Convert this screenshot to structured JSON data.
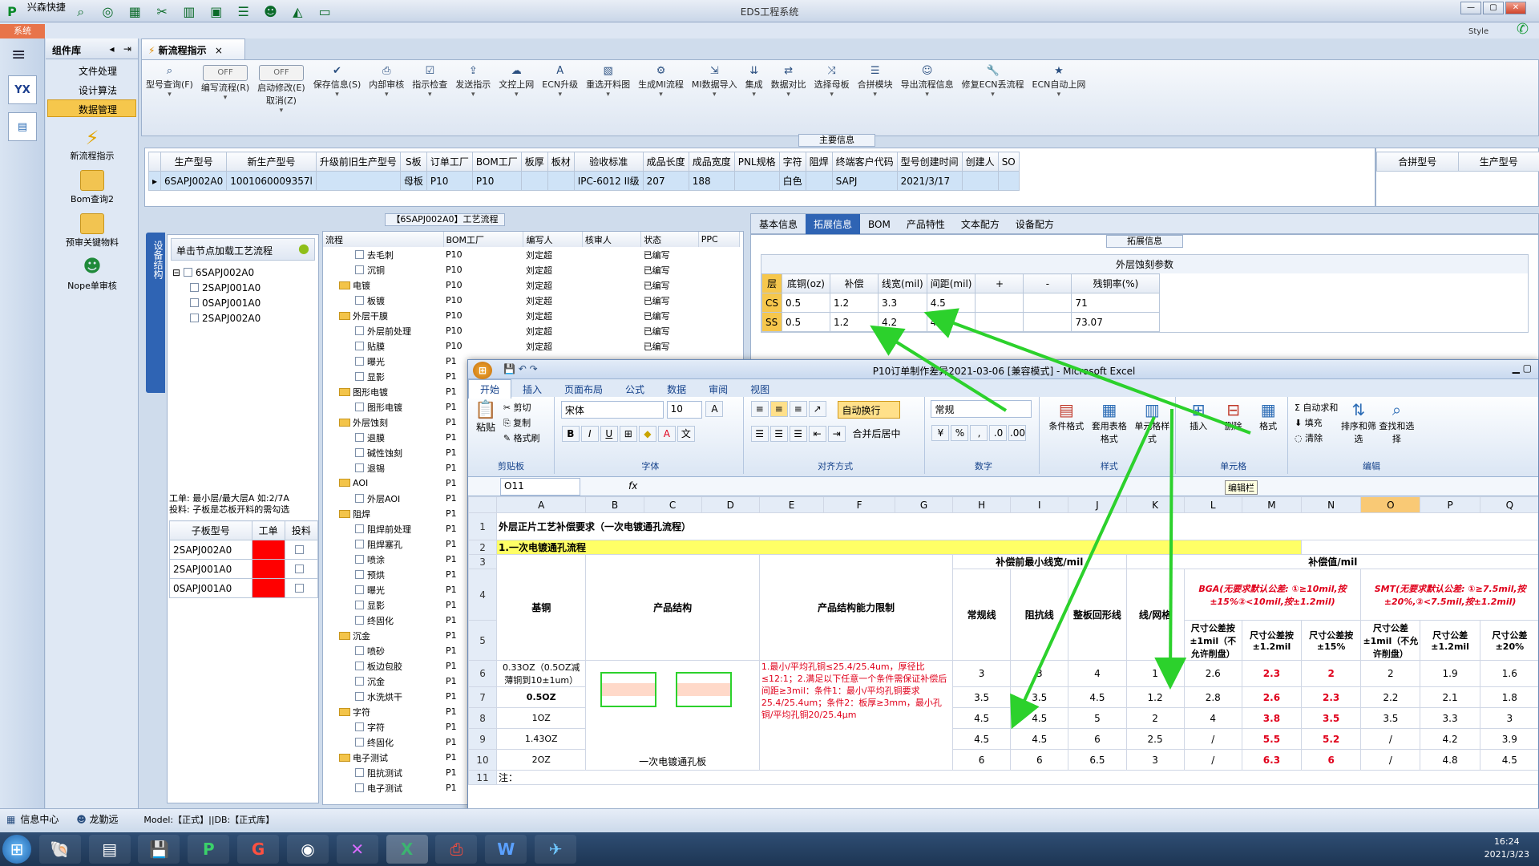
{
  "app": {
    "quick_label": "兴森快捷",
    "title": "EDS工程系统",
    "system_tab": "系统",
    "style_label": "Style"
  },
  "complib": {
    "title": "组件库",
    "items": [
      "文件处理",
      "设计算法",
      "数据管理"
    ],
    "big": [
      "新流程指示",
      "Bom查询2",
      "预审关键物料",
      "Nope单审核"
    ]
  },
  "doc_tab": {
    "label": "新流程指示"
  },
  "ribbon": {
    "items": [
      {
        "icon": "search",
        "label": "型号查询(F)"
      },
      {
        "toggle": "OFF",
        "label": "编写流程(R)"
      },
      {
        "toggle": "OFF",
        "label": "启动修改(E)",
        "label2": "取消(Z)"
      },
      {
        "icon": "check",
        "label": "保存信息(S)"
      },
      {
        "icon": "print",
        "label": "内部审核"
      },
      {
        "icon": "check2",
        "label": "指示检查"
      },
      {
        "icon": "up",
        "label": "发送指示"
      },
      {
        "icon": "cloud",
        "label": "文控上网"
      },
      {
        "icon": "A",
        "label": "ECN升级"
      },
      {
        "icon": "img",
        "label": "重选开料图"
      },
      {
        "icon": "gear",
        "label": "生成MI流程"
      },
      {
        "icon": "import",
        "label": "MI数据导入"
      },
      {
        "icon": "merge",
        "label": "集成"
      },
      {
        "icon": "compare",
        "label": "数据对比"
      },
      {
        "icon": "shuffle",
        "label": "选择母板"
      },
      {
        "icon": "list",
        "label": "合拼模块"
      },
      {
        "icon": "smile",
        "label": "导出流程信息"
      },
      {
        "icon": "wrench",
        "label": "修复ECN丢流程"
      },
      {
        "icon": "star",
        "label": "ECN自动上网"
      }
    ]
  },
  "main_info": {
    "title": "主要信息",
    "columns": [
      "生产型号",
      "新生产型号",
      "升级前旧生产型号",
      "S板",
      "订单工厂",
      "BOM工厂",
      "板厚",
      "板材",
      "验收标准",
      "成品长度",
      "成品宽度",
      "PNL规格",
      "字符",
      "阻焊",
      "终端客户代码",
      "型号创建时间",
      "创建人",
      "SO"
    ],
    "row": [
      "6SAPJ002A0",
      "1001060009357l",
      "",
      "母板",
      "P10",
      "P10",
      "",
      "",
      "IPC-6012 II级",
      "207",
      "188",
      "",
      "白色",
      "",
      "SAPJ",
      "2021/3/17",
      "",
      ""
    ],
    "right_columns": [
      "合拼型号",
      "生产型号"
    ]
  },
  "process_panel": {
    "title": "【6SAPJ002A0】工艺流程",
    "side_tab": "设备结构",
    "load_hint": "单击节点加载工艺流程",
    "tree": [
      "6SAPJ002A0",
      "2SAPJ001A0",
      "0SAPJ001A0",
      "2SAPJ002A0"
    ],
    "note1": "工单: 最小层/最大层A 如:2/7A",
    "note2": "投料: 子板是芯板开料的需勾选",
    "sub_cols": [
      "子板型号",
      "工单",
      "投料"
    ],
    "sub_rows": [
      "2SAPJ002A0",
      "2SAPJ001A0",
      "0SAPJ001A0"
    ]
  },
  "flow": {
    "cols": [
      "流程",
      "BOM工厂",
      "编写人",
      "核审人",
      "状态",
      "PPC"
    ],
    "rows": [
      {
        "name": "去毛刺",
        "lvl": 2,
        "f": "P10",
        "w": "刘定超",
        "s": "已编写"
      },
      {
        "name": "沉铜",
        "lvl": 2,
        "f": "P10",
        "w": "刘定超",
        "s": "已编写"
      },
      {
        "name": "电镀",
        "lvl": 1,
        "f": "P10",
        "w": "刘定超",
        "s": "已编写"
      },
      {
        "name": "板镀",
        "lvl": 2,
        "f": "P10",
        "w": "刘定超",
        "s": "已编写"
      },
      {
        "name": "外层干膜",
        "lvl": 1,
        "f": "P10",
        "w": "刘定超",
        "s": "已编写"
      },
      {
        "name": "外层前处理",
        "lvl": 2,
        "f": "P10",
        "w": "刘定超",
        "s": "已编写"
      },
      {
        "name": "贴膜",
        "lvl": 2,
        "f": "P10",
        "w": "刘定超",
        "s": "已编写"
      },
      {
        "name": "曝光",
        "lvl": 2,
        "f": "P1",
        "w": "",
        "s": ""
      },
      {
        "name": "显影",
        "lvl": 2,
        "f": "P1",
        "w": "",
        "s": ""
      },
      {
        "name": "图形电镀",
        "lvl": 1,
        "f": "P1",
        "w": "",
        "s": ""
      },
      {
        "name": "图形电镀",
        "lvl": 2,
        "f": "P1",
        "w": "",
        "s": ""
      },
      {
        "name": "外层蚀刻",
        "lvl": 1,
        "f": "P1",
        "w": "",
        "s": ""
      },
      {
        "name": "退膜",
        "lvl": 2,
        "f": "P1",
        "w": "",
        "s": ""
      },
      {
        "name": "碱性蚀刻",
        "lvl": 2,
        "f": "P1",
        "w": "",
        "s": ""
      },
      {
        "name": "退锡",
        "lvl": 2,
        "f": "P1",
        "w": "",
        "s": ""
      },
      {
        "name": "AOI",
        "lvl": 1,
        "f": "P1",
        "w": "",
        "s": ""
      },
      {
        "name": "外层AOI",
        "lvl": 2,
        "f": "P1",
        "w": "",
        "s": ""
      },
      {
        "name": "阻焊",
        "lvl": 1,
        "f": "P1",
        "w": "",
        "s": ""
      },
      {
        "name": "阻焊前处理",
        "lvl": 2,
        "f": "P1",
        "w": "",
        "s": ""
      },
      {
        "name": "阻焊塞孔",
        "lvl": 2,
        "f": "P1",
        "w": "",
        "s": ""
      },
      {
        "name": "喷涂",
        "lvl": 2,
        "f": "P1",
        "w": "",
        "s": ""
      },
      {
        "name": "预烘",
        "lvl": 2,
        "f": "P1",
        "w": "",
        "s": ""
      },
      {
        "name": "曝光",
        "lvl": 2,
        "f": "P1",
        "w": "",
        "s": ""
      },
      {
        "name": "显影",
        "lvl": 2,
        "f": "P1",
        "w": "",
        "s": ""
      },
      {
        "name": "终固化",
        "lvl": 2,
        "f": "P1",
        "w": "",
        "s": ""
      },
      {
        "name": "沉金",
        "lvl": 1,
        "f": "P1",
        "w": "",
        "s": ""
      },
      {
        "name": "喷砂",
        "lvl": 2,
        "f": "P1",
        "w": "",
        "s": ""
      },
      {
        "name": "板边包胶",
        "lvl": 2,
        "f": "P1",
        "w": "",
        "s": ""
      },
      {
        "name": "沉金",
        "lvl": 2,
        "f": "P1",
        "w": "",
        "s": ""
      },
      {
        "name": "水洗烘干",
        "lvl": 2,
        "f": "P1",
        "w": "",
        "s": ""
      },
      {
        "name": "字符",
        "lvl": 1,
        "f": "P1",
        "w": "",
        "s": ""
      },
      {
        "name": "字符",
        "lvl": 2,
        "f": "P1",
        "w": "",
        "s": ""
      },
      {
        "name": "终固化",
        "lvl": 2,
        "f": "P1",
        "w": "",
        "s": ""
      },
      {
        "name": "电子测试",
        "lvl": 1,
        "f": "P1",
        "w": "",
        "s": ""
      },
      {
        "name": "阻抗测试",
        "lvl": 2,
        "f": "P1",
        "w": "",
        "s": ""
      },
      {
        "name": "电子测试",
        "lvl": 2,
        "f": "P1",
        "w": "",
        "s": ""
      }
    ]
  },
  "detail": {
    "tabs": [
      "基本信息",
      "拓展信息",
      "BOM",
      "产品特性",
      "文本配方",
      "设备配方"
    ],
    "section": "拓展信息",
    "table_title": "外层蚀刻参数",
    "cols": [
      "层",
      "底铜(oz)",
      "补偿",
      "线宽(mil)",
      "间距(mil)",
      "+",
      "-",
      "残铜率(%)"
    ],
    "rows": [
      [
        "CS",
        "0.5",
        "1.2",
        "3.3",
        "4.5",
        "",
        "",
        "71"
      ],
      [
        "SS",
        "0.5",
        "1.2",
        "4.2",
        "4.5",
        "",
        "",
        "73.07"
      ]
    ]
  },
  "excel": {
    "title": "P10订单制作差异2021-03-06 [兼容模式] - Microsoft Excel",
    "tabs": [
      "开始",
      "插入",
      "页面布局",
      "公式",
      "数据",
      "审阅",
      "视图"
    ],
    "font": "宋体",
    "size": "10",
    "numfmt": "常规",
    "namebox": "O11",
    "groups": [
      "剪贴板",
      "字体",
      "对齐方式",
      "数字",
      "样式",
      "单元格",
      "编辑"
    ],
    "clip": [
      "剪切",
      "复制",
      "格式刷",
      "粘贴"
    ],
    "wrap": "自动换行",
    "mergec": "合并后居中",
    "styles": [
      "条件格式",
      "套用表格格式",
      "单元格样式"
    ],
    "cells": [
      "插入",
      "删除",
      "格式"
    ],
    "edit": [
      "自动求和",
      "填充",
      "清除",
      "排序和筛选",
      "查找和选择"
    ],
    "edit_tip": "编辑栏",
    "col_letters": [
      "A",
      "B",
      "C",
      "D",
      "E",
      "F",
      "G",
      "H",
      "I",
      "J",
      "K",
      "L",
      "M",
      "N",
      "O",
      "P",
      "Q"
    ],
    "r1": "外层正片工艺补偿要求（一次电镀通孔流程）",
    "r2": "1.一次电镀通孔流程",
    "hdr_before": "补偿前最小线宽/mil",
    "hdr_after": "补偿值/mil",
    "hdr": {
      "base": "基铜",
      "struct": "产品结构",
      "limit": "产品结构能力限制",
      "normal": "常规线",
      "imp": "阻抗线",
      "board": "整板回形线",
      "grid": "线/网格"
    },
    "bga": "BGA(无要求默认公差: ①≥10mil,按±15%②<10mil,按±1.2mil)",
    "smt": "SMT(无要求默认公差: ①≥7.5mil,按±20%,②<7.5mil,按±1.2mil)",
    "sub": [
      "尺寸公差按±1mil（不允许削盘）",
      "尺寸公差按±1.2mil",
      "尺寸公差按±15%",
      "尺寸公差±1mil（不允许削盘）",
      "尺寸公差±1.2mil",
      "尺寸公差±20%"
    ],
    "rows": [
      {
        "a": "0.33OZ（0.5OZ减薄铜到10±1um）",
        "v": [
          "3",
          "3",
          "4",
          "1",
          "2.6",
          "2.3",
          "2",
          "2",
          "1.9",
          "1.6"
        ]
      },
      {
        "a": "0.5OZ",
        "v": [
          "3.5",
          "3.5",
          "4.5",
          "1.2",
          "2.8",
          "2.6",
          "2.3",
          "2.2",
          "2.1",
          "1.8"
        ]
      },
      {
        "a": "1OZ",
        "v": [
          "4.5",
          "4.5",
          "5",
          "2",
          "4",
          "3.8",
          "3.5",
          "3.5",
          "3.3",
          "3"
        ]
      },
      {
        "a": "1.43OZ",
        "v": [
          "4.5",
          "4.5",
          "6",
          "2.5",
          "/",
          "5.5",
          "5.2",
          "/",
          "4.2",
          "3.9"
        ]
      },
      {
        "a": "2OZ",
        "v": [
          "6",
          "6",
          "6.5",
          "3",
          "/",
          "6.3",
          "6",
          "/",
          "4.8",
          "4.5"
        ]
      }
    ],
    "limits": "1.最小/平均孔铜≤25.4/25.4um，厚径比≤12:1；2.满足以下任意一个条件需保证补偿后间距≥3mil：条件1：最小/平均孔铜要求25.4/25.4um；条件2：板厚≥3mm，最小孔铜/平均孔铜20/25.4μm",
    "struct_caption": "一次电镀通孔板",
    "note": "注："
  },
  "statusbar": {
    "info": "信息中心",
    "user": "龙勤远",
    "model": "Model:【正式】||DB:【正式库】"
  },
  "tray": {
    "time": "16:24",
    "date": "2021/3/23"
  },
  "colors": {
    "accent": "#2f64b4",
    "red": "#e0001b",
    "yellow": "#ffff66",
    "arrow": "#2cd12c"
  }
}
